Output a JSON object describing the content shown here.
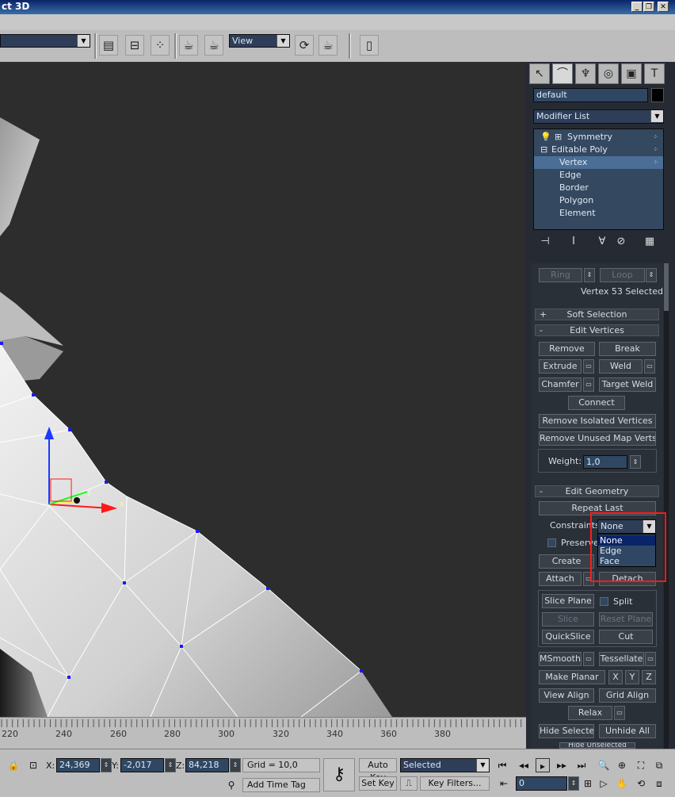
{
  "window": {
    "title": "ct 3D",
    "minimize": "_",
    "restore": "❐",
    "close": "✕"
  },
  "toolbar": {
    "view_combo": "View"
  },
  "panel": {
    "object_name": "default",
    "modifier_list": "Modifier List",
    "stack": [
      {
        "label": "Symmetry",
        "sel": false
      },
      {
        "label": "Editable Poly",
        "sel": false
      },
      {
        "label": "Vertex",
        "sel": true
      },
      {
        "label": "Edge",
        "sel": false
      },
      {
        "label": "Border",
        "sel": false
      },
      {
        "label": "Polygon",
        "sel": false
      },
      {
        "label": "Element",
        "sel": false
      }
    ],
    "ring": "Ring",
    "loop": "Loop",
    "selection_status": "Vertex 53 Selected",
    "soft_selection": "Soft Selection",
    "edit_vertices": "Edit Vertices",
    "remove": "Remove",
    "break": "Break",
    "extrude": "Extrude",
    "weld": "Weld",
    "chamfer": "Chamfer",
    "target_weld": "Target Weld",
    "connect": "Connect",
    "remove_isolated": "Remove Isolated Vertices",
    "remove_unused": "Remove Unused Map Verts",
    "weight_label": "Weight:",
    "weight_value": "1,0",
    "edit_geometry": "Edit Geometry",
    "repeat_last": "Repeat Last",
    "constraints_label": "Constraints:",
    "constraints_value": "None",
    "constraint_options": [
      {
        "label": "None",
        "sel": true
      },
      {
        "label": "Edge",
        "sel": false
      },
      {
        "label": "Face",
        "sel": false
      }
    ],
    "preserve": "Preserve",
    "create": "Create",
    "attach": "Attach",
    "detach": "Detach",
    "slice_plane": "Slice Plane",
    "split": "Split",
    "slice": "Slice",
    "reset_plane": "Reset Plane",
    "quickslice": "QuickSlice",
    "cut": "Cut",
    "msmooth": "MSmooth",
    "tessellate": "Tessellate",
    "make_planar": "Make Planar",
    "x": "X",
    "y": "Y",
    "z": "Z",
    "view_align": "View Align",
    "grid_align": "Grid Align",
    "relax": "Relax",
    "hide_selected": "Hide Selected",
    "unhide_all": "Unhide All",
    "hide_unselected": "Hide Unselected"
  },
  "ruler": {
    "ticks": [
      "220",
      "240",
      "260",
      "280",
      "300",
      "320",
      "340",
      "360",
      "380"
    ]
  },
  "status": {
    "x_label": "X:",
    "x_value": "24,369",
    "y_label": "Y:",
    "y_value": "-2,017",
    "z_label": "Z:",
    "z_value": "84,218",
    "grid": "Grid = 10,0",
    "add_time_tag": "Add Time Tag",
    "auto_key": "Auto Key",
    "set_key": "Set Key",
    "selected": "Selected",
    "key_filters": "Key Filters...",
    "frame": "0"
  },
  "viewport_axes": {
    "z": "z",
    "y": "y",
    "x": "x"
  }
}
